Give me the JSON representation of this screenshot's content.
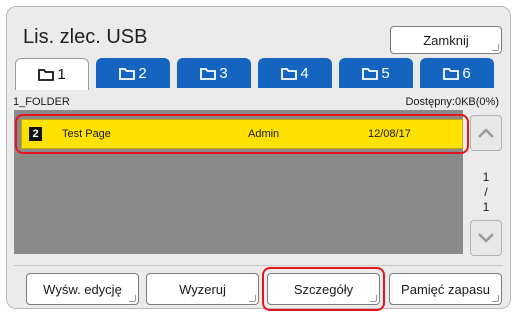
{
  "window": {
    "title": "Lis. zlec. USB",
    "close_label": "Zamknij"
  },
  "tabs": [
    {
      "label": "1",
      "icon": "folder-icon",
      "active": true
    },
    {
      "label": "2",
      "icon": "folder-icon",
      "active": false
    },
    {
      "label": "3",
      "icon": "folder-icon",
      "active": false
    },
    {
      "label": "4",
      "icon": "folder-icon",
      "active": false
    },
    {
      "label": "5",
      "icon": "folder-icon",
      "active": false
    },
    {
      "label": "6",
      "icon": "folder-icon",
      "active": false
    }
  ],
  "folder": {
    "name": "1_FOLDER",
    "available": "Dostępny:0KB(0%)"
  },
  "jobs": [
    {
      "number": "2",
      "name": "Test Page",
      "owner": "Admin",
      "date": "12/08/17",
      "selected": true
    }
  ],
  "pager": {
    "current": "1",
    "separator": "/",
    "total": "1"
  },
  "buttons": {
    "preview": "Wyśw. edycję",
    "reset": "Wyzeruj",
    "details": "Szczegóły",
    "backup": "Pamięć zapasu"
  },
  "colors": {
    "tab_blue": "#1565c0",
    "selected_row": "#ffe100",
    "highlight": "#e4161b",
    "list_bg": "#8a8a8a"
  }
}
